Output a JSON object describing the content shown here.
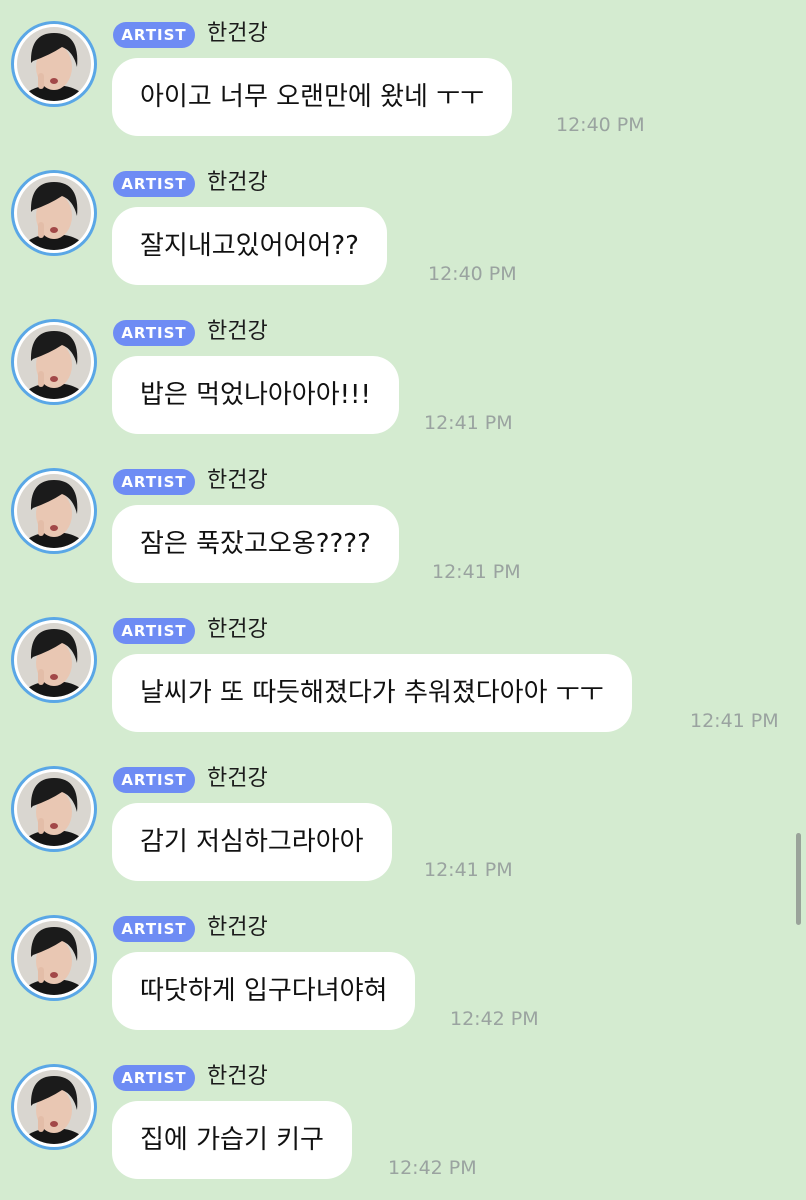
{
  "badge_label": "ARTIST",
  "sender_name": "한건강",
  "colors": {
    "background": "#d4ebd0",
    "badge": "#6e8cf4",
    "avatar_ring": "#5aa7e6",
    "bubble": "#ffffff",
    "time_text": "#9aa3a0"
  },
  "messages": [
    {
      "text": "아이고 너무 오랜만에 왔네 ㅜㅜ",
      "time": "12:40 PM"
    },
    {
      "text": "잘지내고있어어어??",
      "time": "12:40 PM"
    },
    {
      "text": "밥은 먹었나아아아!!!",
      "time": "12:41 PM"
    },
    {
      "text": "잠은 푹잤고오옹????",
      "time": "12:41 PM"
    },
    {
      "text": "날씨가 또 따듯해졌다가 추워졌다아아 ㅜㅜ",
      "time": "12:41 PM"
    },
    {
      "text": "감기 저심하그라아아",
      "time": "12:41 PM"
    },
    {
      "text": "따닷하게 입구다녀야혀",
      "time": "12:42 PM"
    },
    {
      "text": "집에 가습기 키구",
      "time": "12:42 PM"
    }
  ]
}
